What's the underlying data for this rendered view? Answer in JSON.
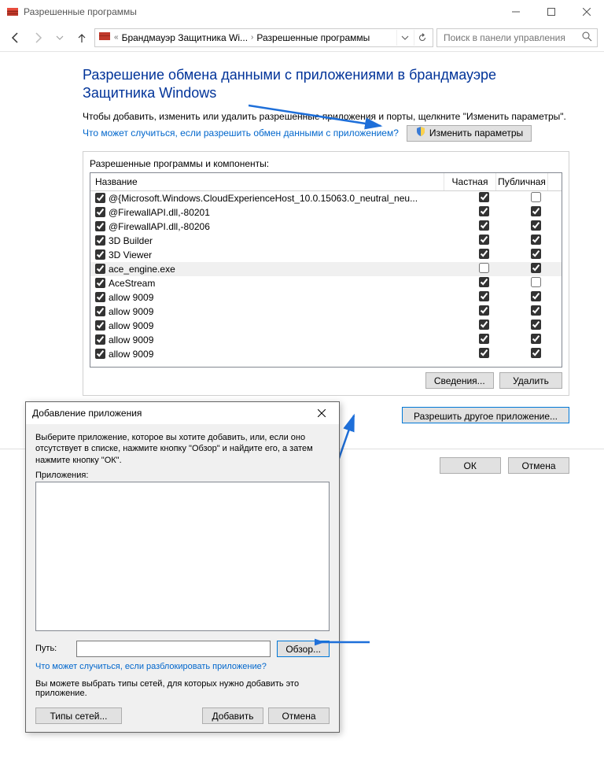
{
  "window": {
    "title": "Разрешенные программы"
  },
  "nav": {
    "crumb1": "Брандмауэр Защитника Wi...",
    "crumb2": "Разрешенные программы",
    "search_placeholder": "Поиск в панели управления"
  },
  "page": {
    "heading": "Разрешение обмена данными с приложениями в брандмауэре Защитника Windows",
    "intro": "Чтобы добавить, изменить или удалить разрешенные приложения и порты, щелкните \"Изменить параметры\".",
    "risk_link": "Что может случиться, если разрешить обмен данными с приложением?",
    "change_btn": "Изменить параметры",
    "group_label": "Разрешенные программы и компоненты:",
    "col_name": "Название",
    "col_private": "Частная",
    "col_public": "Публичная",
    "details_btn": "Сведения...",
    "delete_btn": "Удалить",
    "allow_other_btn": "Разрешить другое приложение..."
  },
  "items": [
    {
      "en": true,
      "name": "@{Microsoft.Windows.CloudExperienceHost_10.0.15063.0_neutral_neu...",
      "priv": true,
      "pub": false,
      "sel": false
    },
    {
      "en": true,
      "name": "@FirewallAPI.dll,-80201",
      "priv": true,
      "pub": true,
      "sel": false
    },
    {
      "en": true,
      "name": "@FirewallAPI.dll,-80206",
      "priv": true,
      "pub": true,
      "sel": false
    },
    {
      "en": true,
      "name": "3D Builder",
      "priv": true,
      "pub": true,
      "sel": false
    },
    {
      "en": true,
      "name": "3D Viewer",
      "priv": true,
      "pub": true,
      "sel": false
    },
    {
      "en": true,
      "name": "ace_engine.exe",
      "priv": false,
      "pub": true,
      "sel": true
    },
    {
      "en": true,
      "name": "AceStream",
      "priv": true,
      "pub": false,
      "sel": false
    },
    {
      "en": true,
      "name": "allow 9009",
      "priv": true,
      "pub": true,
      "sel": false
    },
    {
      "en": true,
      "name": "allow 9009",
      "priv": true,
      "pub": true,
      "sel": false
    },
    {
      "en": true,
      "name": "allow 9009",
      "priv": true,
      "pub": true,
      "sel": false
    },
    {
      "en": true,
      "name": "allow 9009",
      "priv": true,
      "pub": true,
      "sel": false
    },
    {
      "en": true,
      "name": "allow 9009",
      "priv": true,
      "pub": true,
      "sel": false
    }
  ],
  "dialog": {
    "title": "Добавление приложения",
    "instr": "Выберите приложение, которое вы хотите добавить, или, если оно отсутствует в списке, нажмите кнопку \"Обзор\" и найдите его, а затем нажмите кнопку \"ОК\".",
    "apps_label": "Приложения:",
    "path_label": "Путь:",
    "browse_btn": "Обзор...",
    "unblock_link": "Что может случиться, если разблокировать приложение?",
    "note": "Вы можете выбрать типы сетей, для которых нужно добавить это приложение.",
    "nets_btn": "Типы сетей...",
    "add_btn": "Добавить",
    "cancel_btn": "Отмена"
  },
  "footer": {
    "ok": "ОК",
    "cancel": "Отмена"
  }
}
